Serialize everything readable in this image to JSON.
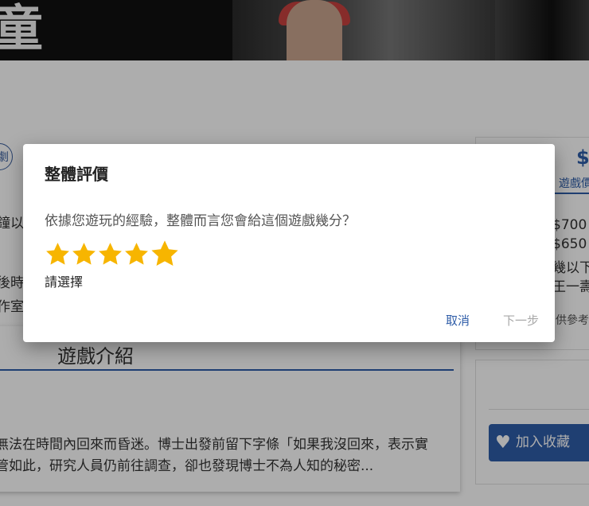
{
  "background": {
    "banner_title": "童",
    "tag_chip": "劇",
    "left_fragments": [
      "鐘以",
      "後時間",
      "作室"
    ],
    "intro_title": "遊戲介紹",
    "intro_lines": [
      "無法在時間內回來而昏迷。博士出發前留下字條「如果我沒回來，表示實",
      "管如此，研究人員仍前往調查，卻也發現博士不為人知的秘密..."
    ],
    "price_big": "$",
    "price_tab": "遊戲價",
    "price_rows": [
      "$700 /",
      "$650 /",
      "幾以下",
      "王一壽"
    ],
    "note": "供參考",
    "favorite_label": "加入收藏"
  },
  "dialog": {
    "title": "整體評價",
    "question": "依據您遊玩的經驗，整體而言您會給這個遊戲幾分？",
    "rating": {
      "value": 5,
      "max": 5,
      "star_color": "#f7b500",
      "icon": "star-icon"
    },
    "hint": "請選擇",
    "cancel_label": "取消",
    "next_label": "下一步"
  },
  "colors": {
    "accent": "#2f5da8",
    "disabled": "#a8a8a8"
  }
}
